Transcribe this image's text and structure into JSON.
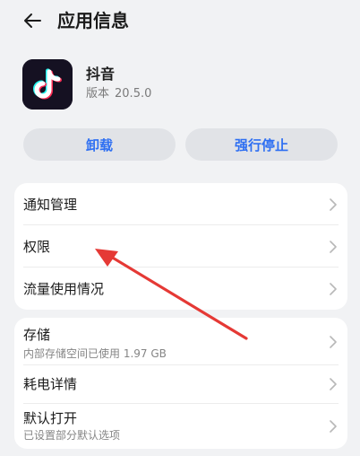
{
  "header": {
    "title": "应用信息"
  },
  "app": {
    "name": "抖音",
    "version_label": "版本",
    "version": "20.5.0"
  },
  "actions": {
    "uninstall_label": "卸载",
    "force_stop_label": "强行停止"
  },
  "settings_group_1": [
    {
      "label": "通知管理"
    },
    {
      "label": "权限"
    },
    {
      "label": "流量使用情况"
    }
  ],
  "settings_group_2": [
    {
      "label": "存储",
      "sub": "内部存储空间已使用 1.97 GB"
    },
    {
      "label": "耗电详情"
    },
    {
      "label": "默认打开",
      "sub": "已设置部分默认选项"
    }
  ],
  "colors": {
    "accent": "#2e6ff2",
    "background": "#f1f2f4",
    "annotation": "#e53935"
  },
  "icons": {
    "back": "arrow-left-icon",
    "chevron": "chevron-right-icon",
    "app": "tiktok-logo-icon"
  }
}
